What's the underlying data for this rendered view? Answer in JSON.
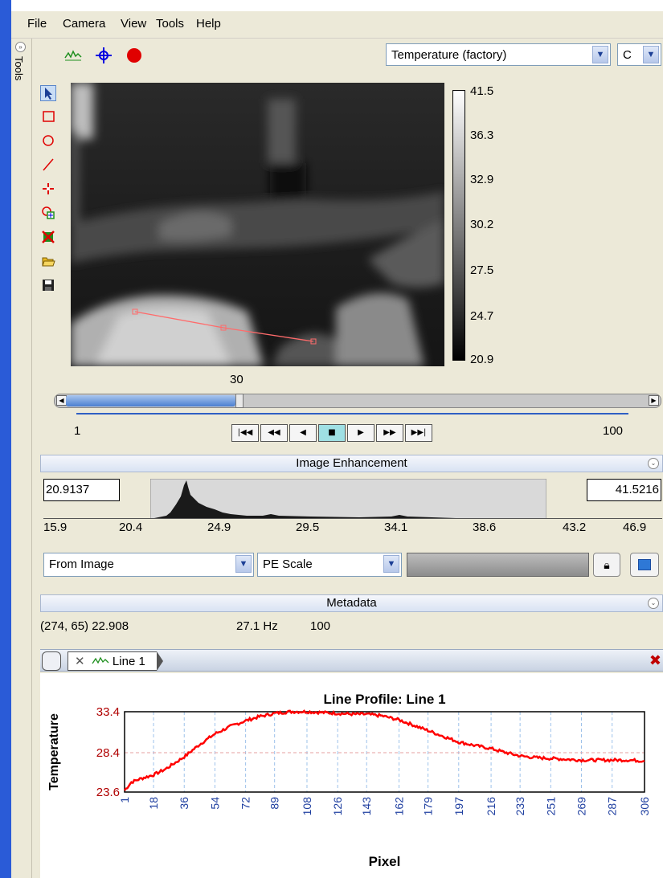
{
  "menu": [
    "File",
    "Camera",
    "View",
    "Tools",
    "Help"
  ],
  "side_panel": {
    "label": "Tools"
  },
  "toolbar": {
    "icons": [
      "line-profile-icon",
      "crosshair-icon",
      "record-icon"
    ],
    "palette_value": "Temperature (factory)",
    "unit_value": "C"
  },
  "draw_tools": [
    "select-arrow-icon",
    "rectangle-icon",
    "ellipse-icon",
    "line-icon",
    "spot-icon",
    "add-roi-icon",
    "delete-roi-icon",
    "open-folder-icon",
    "save-icon"
  ],
  "colorbar": {
    "labels": [
      "41.5",
      "36.3",
      "32.9",
      "30.2",
      "27.5",
      "24.7",
      "20.9"
    ]
  },
  "frame": {
    "current": "30",
    "min": "1",
    "max": "100",
    "fraction": 0.29
  },
  "playback": [
    "first-frame",
    "previous-fast",
    "previous",
    "stop",
    "next",
    "next-fast",
    "last-frame"
  ],
  "enhancement": {
    "title": "Image Enhancement",
    "low": "20.9137",
    "high": "41.5216",
    "ticks": [
      "15.9",
      "20.4",
      "24.9",
      "29.5",
      "34.1",
      "38.6",
      "43.2",
      "46.9"
    ],
    "source": "From Image",
    "scale": "PE Scale"
  },
  "metadata": {
    "title": "Metadata",
    "coords": "(274, 65) 22.908",
    "rate": "27.1 Hz",
    "value": "100"
  },
  "tab": {
    "label": "Line 1"
  },
  "chart_data": {
    "type": "line",
    "title": "Line Profile: Line 1",
    "xlabel": "Pixel",
    "ylabel": "Temperature",
    "x_ticks": [
      "1",
      "18",
      "36",
      "54",
      "72",
      "89",
      "108",
      "126",
      "143",
      "162",
      "179",
      "197",
      "216",
      "233",
      "251",
      "269",
      "287",
      "306"
    ],
    "y_ticks": [
      "33.4",
      "28.4",
      "23.6"
    ],
    "xlim": [
      1,
      306
    ],
    "ylim": [
      23.6,
      33.4
    ],
    "grid": true,
    "series": [
      {
        "color": "#ff0000",
        "x": [
          1,
          5,
          10,
          18,
          25,
          36,
          45,
          54,
          63,
          72,
          80,
          89,
          98,
          108,
          117,
          126,
          135,
          143,
          152,
          162,
          170,
          179,
          188,
          197,
          206,
          216,
          225,
          233,
          242,
          251,
          260,
          269,
          278,
          287,
          296,
          306
        ],
        "y": [
          23.8,
          24.8,
          25.2,
          25.7,
          26.4,
          27.9,
          29.4,
          30.7,
          31.6,
          32.3,
          32.8,
          33.2,
          33.4,
          33.4,
          33.3,
          33.2,
          33.1,
          33.1,
          32.9,
          32.4,
          31.8,
          31.1,
          30.4,
          29.7,
          29.3,
          28.9,
          28.4,
          28.0,
          27.8,
          27.7,
          27.6,
          27.5,
          27.5,
          27.5,
          27.5,
          27.4
        ]
      }
    ]
  }
}
